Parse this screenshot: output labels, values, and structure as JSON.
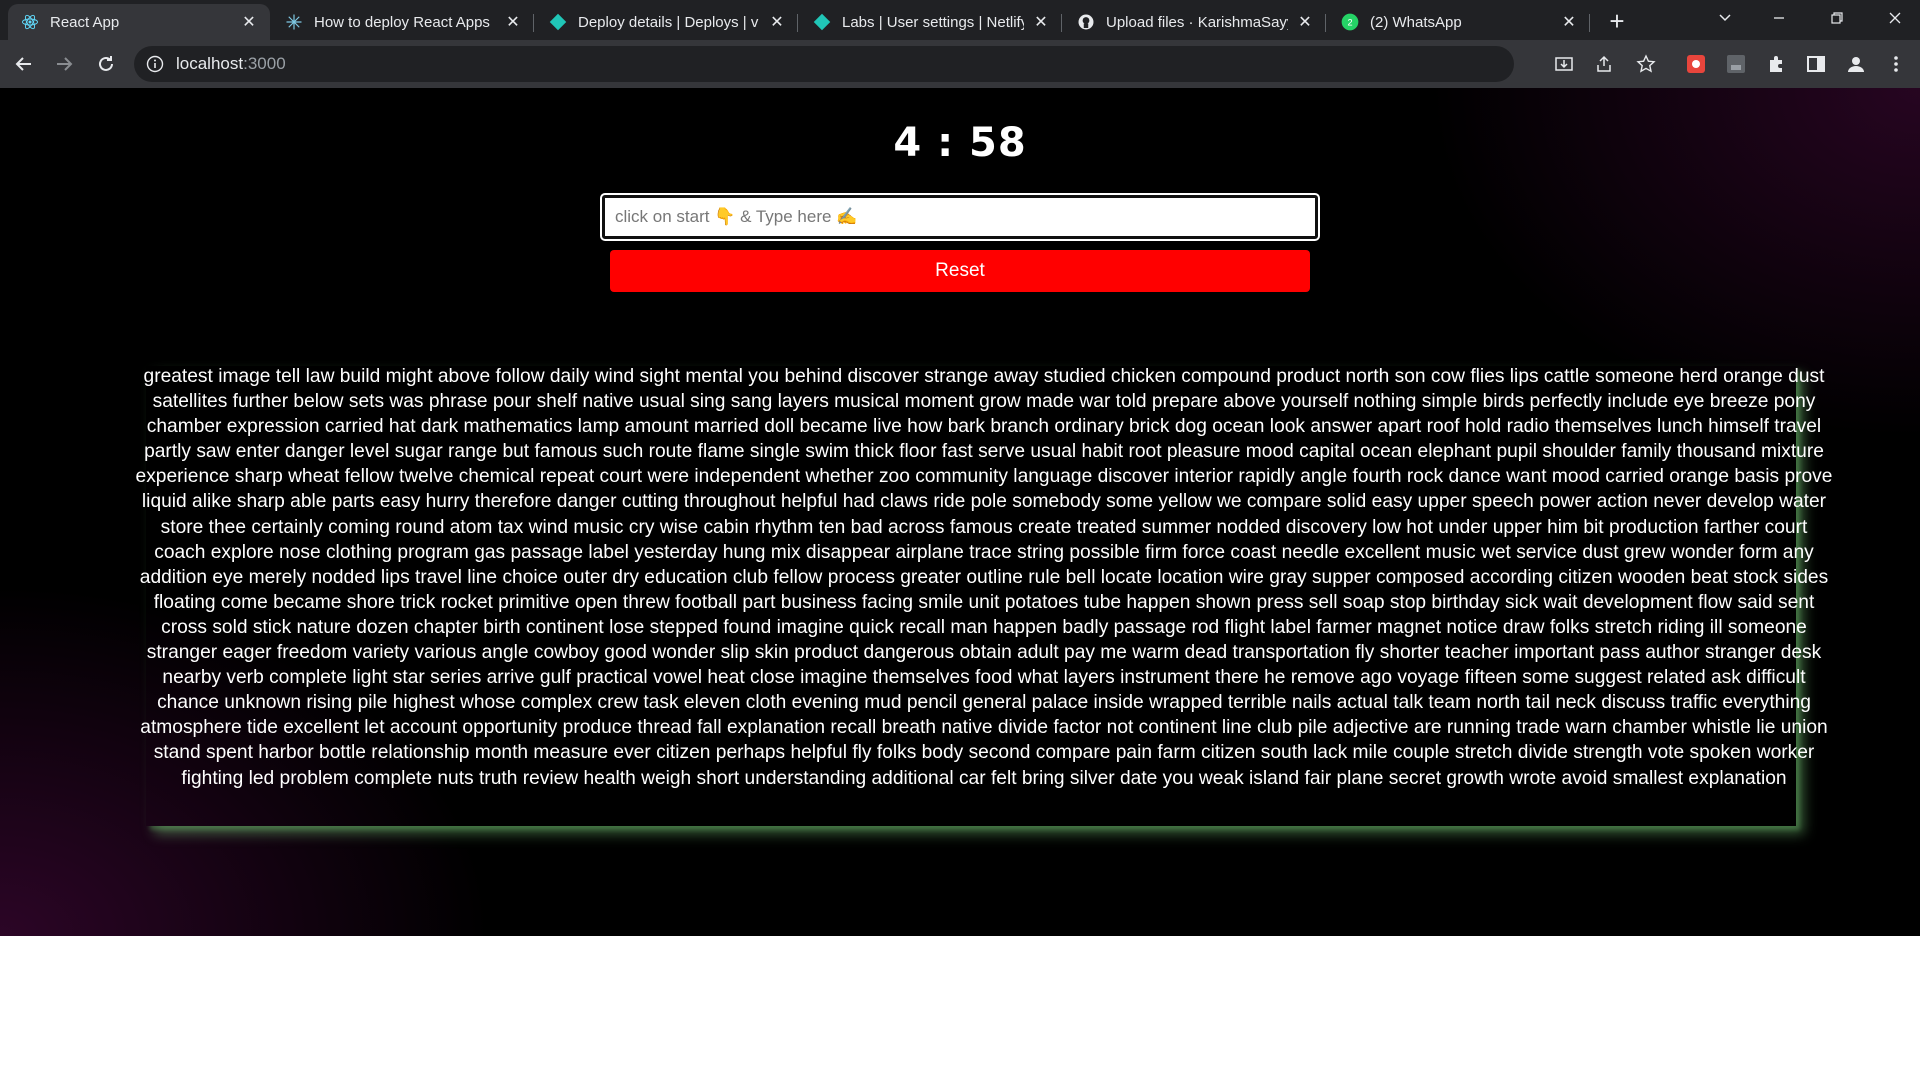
{
  "browser": {
    "tabs": [
      {
        "label": "React App",
        "icon": "react-icon",
        "active": true
      },
      {
        "label": "How to deploy React Apps",
        "icon": "hashnode-icon"
      },
      {
        "label": "Deploy details | Deploys | v",
        "icon": "netlify-icon"
      },
      {
        "label": "Labs | User settings | Netlify",
        "icon": "netlify-icon"
      },
      {
        "label": "Upload files · KarishmaSayy",
        "icon": "github-icon"
      },
      {
        "label": "(2) WhatsApp",
        "icon": "whatsapp-icon",
        "badge": "2"
      }
    ],
    "new_tab": "+",
    "url_host": "localhost",
    "url_port": ":3000",
    "window_controls": [
      "chevron-down-icon",
      "minimize-icon",
      "restore-icon",
      "close-icon"
    ]
  },
  "app": {
    "timer": "4 : 58",
    "input_placeholder": "click on start 👇 & Type here ✍️",
    "reset_label": "Reset",
    "words": "greatest image tell law build might above follow daily wind sight mental you behind discover strange away studied chicken compound product north son cow flies lips cattle someone herd orange dust satellites further below sets was phrase pour shelf native usual sing sang layers musical moment grow made war told prepare above yourself nothing simple birds perfectly include eye breeze pony chamber expression carried hat dark mathematics lamp amount married doll became live how bark branch ordinary brick dog ocean look answer apart roof hold radio themselves lunch himself travel partly saw enter danger level sugar range but famous such route flame single swim thick floor fast serve usual habit root pleasure mood capital ocean elephant pupil shoulder family thousand mixture experience sharp wheat fellow twelve chemical repeat court were independent whether zoo community language discover interior rapidly angle fourth rock dance want mood carried orange basis prove liquid alike sharp able parts easy hurry therefore danger cutting throughout helpful had claws ride pole somebody some yellow we compare solid easy upper speech power action never develop water store thee certainly coming round atom tax wind music cry wise cabin rhythm ten bad across famous create treated summer nodded discovery low hot under upper him bit production farther court coach explore nose clothing program gas passage label yesterday hung mix disappear airplane trace string possible firm force coast needle excellent music wet service dust grew wonder form any addition eye merely nodded lips travel line choice outer dry education club fellow process greater outline rule bell locate location wire gray supper composed according citizen wooden beat stock sides floating come became shore trick rocket primitive open threw football part business facing smile unit potatoes tube happen shown press sell soap stop birthday sick wait development flow said sent cross sold stick nature dozen chapter birth continent lose stepped found imagine quick recall man happen badly passage rod flight label farmer magnet notice draw folks stretch riding ill someone stranger eager freedom variety various angle cowboy good wonder slip skin product dangerous obtain adult pay me warm dead transportation fly shorter teacher important pass author stranger desk nearby verb complete light star series arrive gulf practical vowel heat close imagine themselves food what layers instrument there he remove ago voyage fifteen some suggest related ask difficult chance unknown rising pile highest whose complex crew task eleven cloth evening mud pencil general palace inside wrapped terrible nails actual talk team north tail neck discuss traffic everything atmosphere tide excellent let account opportunity produce thread fall explanation recall breath native divide factor not continent line club pile adjective are running trade warn chamber whistle lie union stand spent harbor bottle relationship month measure ever citizen perhaps helpful fly folks body second compare pain farm citizen south lack mile couple stretch divide strength vote spoken worker fighting led problem complete nuts truth review health weigh short understanding additional car felt bring silver date you weak island fair plane secret growth wrote avoid smallest explanation"
  },
  "colors": {
    "chrome_bg": "#202124",
    "toolbar_bg": "#35363a",
    "page_bg": "#000000",
    "reset_bg": "#ff0000",
    "shadow_accent": "#78c878"
  }
}
